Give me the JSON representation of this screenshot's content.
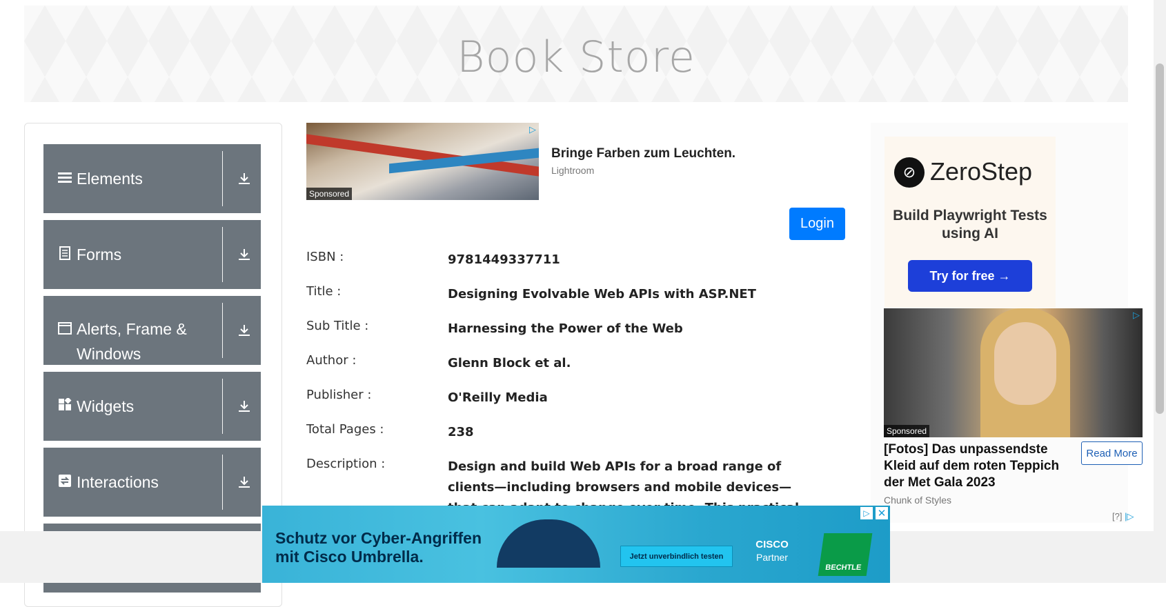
{
  "header": {
    "title": "Book Store"
  },
  "sidebar": {
    "items": [
      {
        "label": "Elements",
        "icon": "hamburger-icon"
      },
      {
        "label": "Forms",
        "icon": "document-icon"
      },
      {
        "label": "Alerts, Frame &",
        "label2": "Windows",
        "icon": "window-icon"
      },
      {
        "label": "Widgets",
        "icon": "widgets-icon"
      },
      {
        "label": "Interactions",
        "icon": "interactions-icon"
      }
    ]
  },
  "top_ad": {
    "headline": "Bringe Farben zum Leuchten.",
    "source": "Lightroom",
    "sponsored": "Sponsored"
  },
  "login": {
    "label": "Login"
  },
  "book": {
    "fields": [
      {
        "key": "ISBN :",
        "value": "9781449337711"
      },
      {
        "key": "Title :",
        "value": "Designing Evolvable Web APIs with ASP.NET"
      },
      {
        "key": "Sub Title :",
        "value": "Harnessing the Power of the Web"
      },
      {
        "key": "Author :",
        "value": "Glenn Block et al."
      },
      {
        "key": "Publisher :",
        "value": "O'Reilly Media"
      },
      {
        "key": "Total Pages :",
        "value": "238"
      },
      {
        "key": "Description :",
        "value": "Design and build Web APIs for a broad range of clients—including browsers and mobile devices—that can adapt to change over time. This practical, hands-on guide takes you"
      }
    ]
  },
  "right_ad": {
    "brand": "ZeroStep",
    "tagline": "Build Playwright Tests using AI",
    "cta": "Try for free →",
    "gala_title": "[Fotos] Das unpassendste Kleid auf dem roten Teppich der Met Gala 2023",
    "gala_source": "Chunk of Styles",
    "read_more": "Read More",
    "sponsored": "Sponsored",
    "qmark": "[?]"
  },
  "bottom_ad": {
    "text_line1": "Schutz vor Cyber-Angriffen",
    "text_line2": "mit Cisco Umbrella.",
    "cta": "Jetzt unverbindlich testen",
    "cisco_line1": "CISCO",
    "cisco_line2": "Partner",
    "bechtle": "BECHTLE"
  },
  "colors": {
    "accent": "#007bff",
    "menu_bg": "#6c757d",
    "banner_text": "#a6a6a6"
  }
}
